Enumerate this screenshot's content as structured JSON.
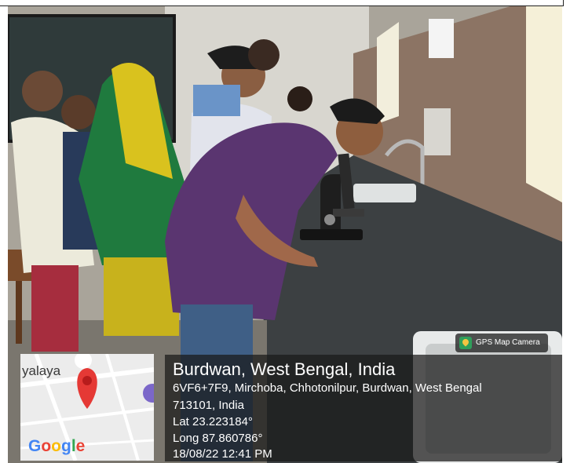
{
  "overlay": {
    "badge_label": "GPS Map Camera",
    "title": "Burdwan, West Bengal, India",
    "address_line1": "6VF6+7F9, Mirchoba, Chhotonilpur, Burdwan, West Bengal",
    "address_line2": "713101, India",
    "lat": "Lat 23.223184°",
    "long": "Long 87.860786°",
    "datetime": "18/08/22 12:41 PM"
  },
  "map": {
    "place_label": "yalaya",
    "google_label": "Google",
    "pin_color": "#e53935"
  },
  "colors": {
    "overlay_bg": "#191919",
    "badge_icon": "#2f9e5b"
  }
}
